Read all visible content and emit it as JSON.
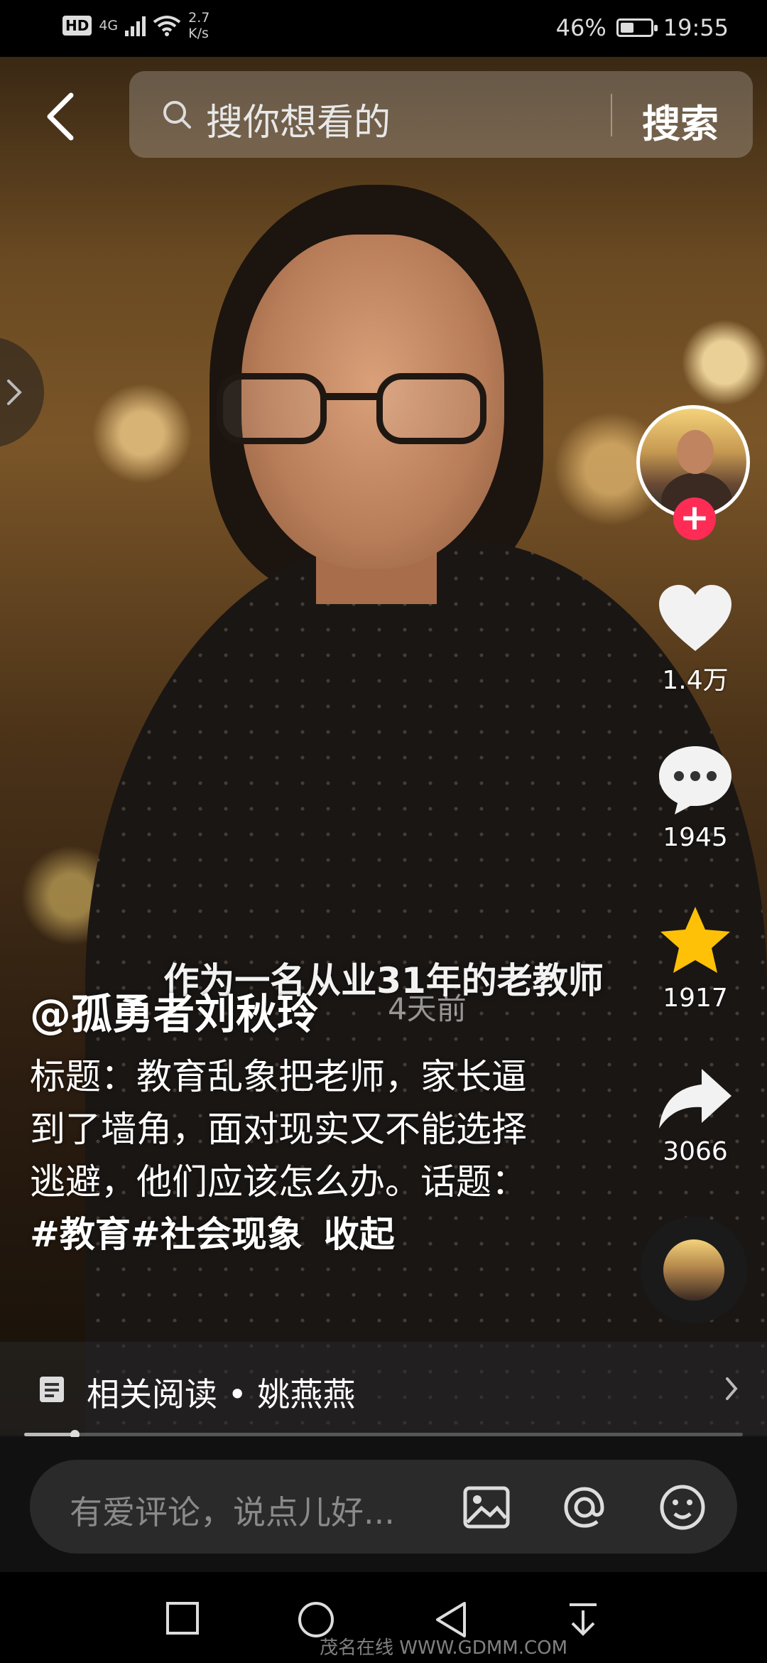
{
  "status_bar": {
    "hd_label": "HD",
    "network_type": "4G",
    "net_speed_value": "2.7",
    "net_speed_unit": "K/s",
    "battery_percent": "46%",
    "battery_level": 0.46,
    "time": "19:55"
  },
  "search": {
    "placeholder": "搜你想看的",
    "button_label": "搜索"
  },
  "video": {
    "subtitle": "作为一名从业31年的老教师"
  },
  "post": {
    "author": "@孤勇者刘秋玲",
    "time_ago": "4天前",
    "description_prefix": "标题：教育乱象把老师，家长逼到了墙角，面对现实又不能选择逃避，他们应该怎么办。话题：",
    "hashtags": "#教育#社会现象",
    "collapse_label": "收起"
  },
  "actions": {
    "like_count": "1.4万",
    "comment_count": "1945",
    "favorite_count": "1917",
    "share_count": "3066",
    "follow_symbol": "+"
  },
  "related": {
    "label": "相关阅读 • 姚燕燕"
  },
  "progress": {
    "played_fraction": 0.07
  },
  "comment_bar": {
    "placeholder": "有爱评论，说点儿好..."
  },
  "watermark": "茂名在线 WWW.GDMM.COM",
  "colors": {
    "follow_accent": "#fe2c55",
    "favorite_star": "#ffc107"
  },
  "icons": [
    "back-icon",
    "search-icon",
    "chevron-right-icon",
    "heart-icon",
    "comment-icon",
    "star-icon",
    "share-icon",
    "document-icon",
    "image-icon",
    "at-icon",
    "emoji-icon",
    "nav-recents-icon",
    "nav-home-icon",
    "nav-back-icon",
    "nav-down-icon"
  ]
}
